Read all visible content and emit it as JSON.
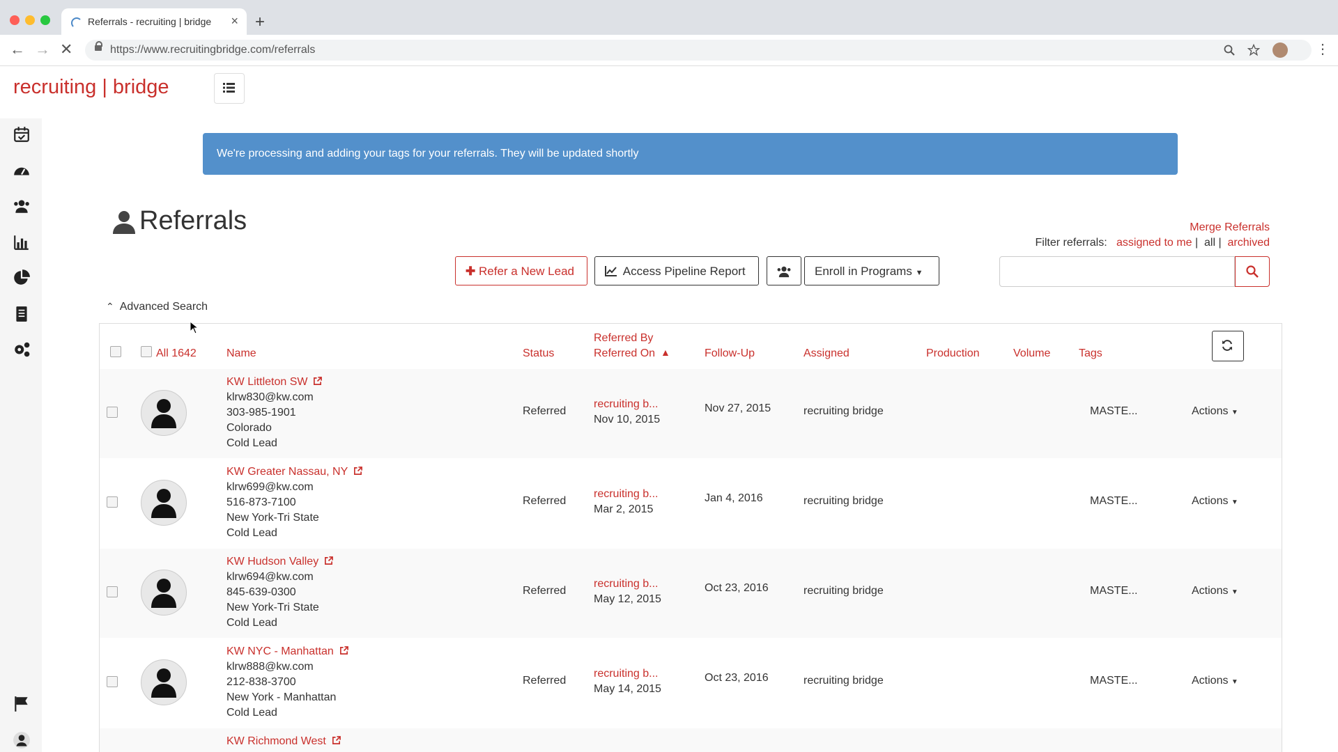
{
  "browser": {
    "tab_title": "Referrals - recruiting | bridge",
    "url": "https://www.recruitingbridge.com/referrals"
  },
  "app": {
    "logo": "recruiting | bridge"
  },
  "alert": {
    "message": "We're processing and adding your tags for your referrals. They will be updated shortly"
  },
  "page": {
    "title": "Referrals",
    "merge_link": "Merge Referrals",
    "filter_label": "Filter referrals:",
    "filter_assigned": "assigned to me",
    "filter_all": "all",
    "filter_archived": "archived",
    "sep": "|"
  },
  "toolbar": {
    "refer_new_lead": "Refer a New Lead",
    "access_pipeline": "Access Pipeline Report",
    "enroll_programs": "Enroll in Programs"
  },
  "advanced_search": "Advanced Search",
  "table": {
    "all_count": "All 1642",
    "headers": {
      "name": "Name",
      "status": "Status",
      "referred_by": "Referred By",
      "referred_on": "Referred On",
      "follow_up": "Follow-Up",
      "assigned": "Assigned",
      "production": "Production",
      "volume": "Volume",
      "tags": "Tags"
    },
    "rows": [
      {
        "name": "KW Littleton SW",
        "email": "klrw830@kw.com",
        "phone": "303-985-1901",
        "region": "Colorado",
        "lead": "Cold Lead",
        "status": "Referred",
        "referred_by": "recruiting b...",
        "referred_on": "Nov 10, 2015",
        "follow_up": "Nov 27, 2015",
        "assigned": "recruiting bridge",
        "tags": "MASTE...",
        "actions": "Actions"
      },
      {
        "name": "KW Greater Nassau, NY",
        "email": "klrw699@kw.com",
        "phone": "516-873-7100",
        "region": "New York-Tri State",
        "lead": "Cold Lead",
        "status": "Referred",
        "referred_by": "recruiting b...",
        "referred_on": "Mar 2, 2015",
        "follow_up": "Jan 4, 2016",
        "assigned": "recruiting bridge",
        "tags": "MASTE...",
        "actions": "Actions"
      },
      {
        "name": "KW Hudson Valley",
        "email": "klrw694@kw.com",
        "phone": "845-639-0300",
        "region": "New York-Tri State",
        "lead": "Cold Lead",
        "status": "Referred",
        "referred_by": "recruiting b...",
        "referred_on": "May 12, 2015",
        "follow_up": "Oct 23, 2016",
        "assigned": "recruiting bridge",
        "tags": "MASTE...",
        "actions": "Actions"
      },
      {
        "name": "KW NYC - Manhattan",
        "email": "klrw888@kw.com",
        "phone": "212-838-3700",
        "region": "New York - Manhattan",
        "lead": "Cold Lead",
        "status": "Referred",
        "referred_by": "recruiting b...",
        "referred_on": "May 14, 2015",
        "follow_up": "Oct 23, 2016",
        "assigned": "recruiting bridge",
        "tags": "MASTE...",
        "actions": "Actions"
      },
      {
        "name": "KW Richmond West"
      }
    ]
  }
}
